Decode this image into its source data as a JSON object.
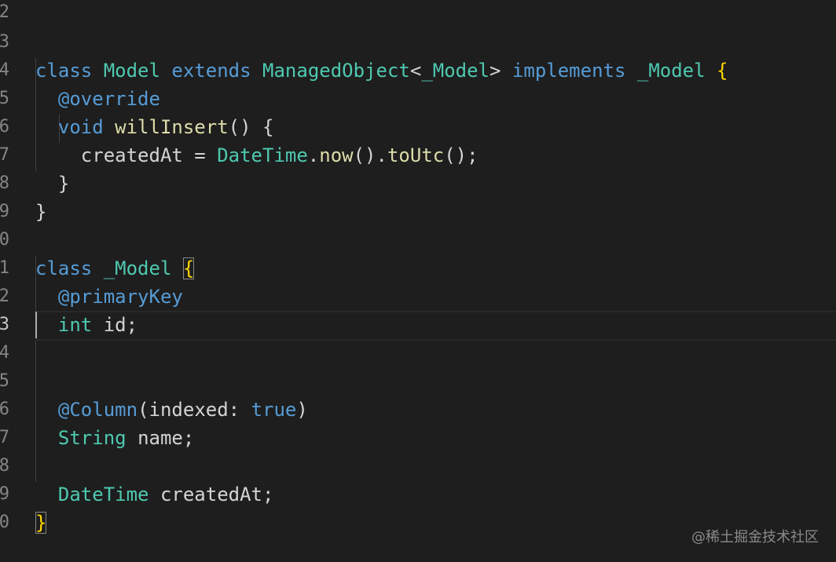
{
  "gutter": [
    "2",
    "3",
    "4",
    "5",
    "6",
    "7",
    "8",
    "9",
    "0",
    "1",
    "2",
    "3",
    "4",
    "5",
    "6",
    "7",
    "8",
    "9",
    "0"
  ],
  "lines": {
    "l3": {
      "kw1": "class",
      "t1": "Model",
      "kw2": "extends",
      "t2": "ManagedObject",
      "p1": "<",
      "t3": "_Model",
      "p2": ">",
      "kw3": "implements",
      "t4": "_Model",
      "b1": "{"
    },
    "l4": {
      "a": "@override"
    },
    "l5": {
      "kw": "void",
      "fn": "willInsert",
      "p": "()",
      "b": "{"
    },
    "l6": {
      "v": "createdAt",
      "eq": "=",
      "t": "DateTime",
      "d1": ".",
      "f1": "now",
      "p1": "()",
      "d2": ".",
      "f2": "toUtc",
      "p2": "()",
      "semi": ";"
    },
    "l7": {
      "b": "}"
    },
    "l8": {
      "b": "}"
    },
    "l10": {
      "kw": "class",
      "t": "_Model",
      "b": "{"
    },
    "l11": {
      "a": "@primaryKey"
    },
    "l12": {
      "kw": "int",
      "v": "id;"
    },
    "l15": {
      "a": "@Column",
      "p1": "(",
      "arg": "indexed:",
      "val": "true",
      "p2": ")"
    },
    "l16": {
      "t": "String",
      "v": "name;"
    },
    "l18": {
      "t": "DateTime",
      "v": "createdAt;"
    },
    "l19": {
      "b": "}"
    }
  },
  "watermark": "@稀土掘金技术社区",
  "colors": {
    "background": "#1e1e1e",
    "keyword": "#569cd6",
    "type": "#4ec9b0",
    "function": "#dcdcaa",
    "bracket": "#ffd700",
    "text": "#d4d4d4"
  }
}
